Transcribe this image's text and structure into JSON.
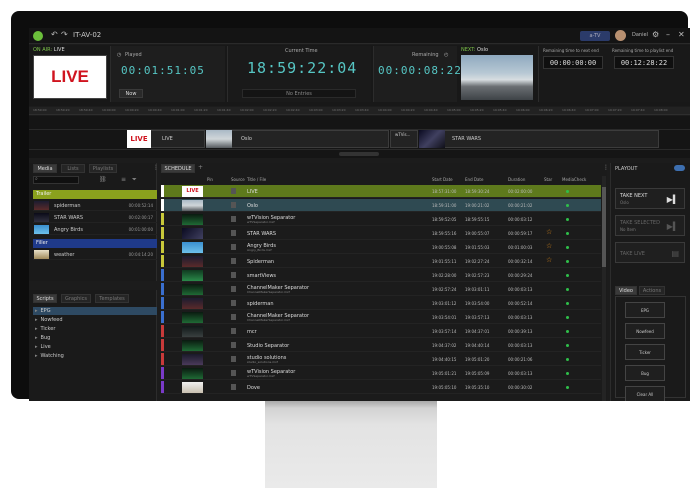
{
  "app": {
    "window_title": "IT-AV-02",
    "badge": "a-TV",
    "user": "Daniel"
  },
  "onair": {
    "label_prefix": "ON AIR:",
    "label_value": "LIVE",
    "live_text": "LIVE",
    "played_label": "Played",
    "played_time": "00:01:51:05",
    "now_button": "Now",
    "current_time_label": "Current Time",
    "current_time": "18:59:22:04",
    "no_entry": "No Entries",
    "remaining_label": "Remaining",
    "remaining_time": "00:00:08:22",
    "next_label": "NEXT:",
    "next_value": "Oslo",
    "rem_next_end_label": "Remaining time to next end",
    "rem_next_end": "00:00:00:00",
    "rem_playlist_end_label": "Remaining time to playlist end",
    "rem_playlist_end": "00:12:28:22"
  },
  "ruler_ticks": [
    "18:59:00",
    "18:59:20",
    "18:59:40",
    "19:00:00",
    "19:00:20",
    "19:00:40",
    "19:01:00",
    "19:01:20",
    "19:01:40",
    "19:02:00",
    "19:02:20",
    "19:02:40",
    "19:03:00",
    "19:03:20",
    "19:03:40",
    "19:04:00",
    "19:04:20",
    "19:04:40",
    "19:05:00",
    "19:05:20",
    "19:05:40",
    "19:06:00",
    "19:06:20",
    "19:06:40",
    "19:07:00",
    "19:07:20",
    "19:07:40",
    "19:08:00"
  ],
  "timeline": {
    "live_text": "LIVE",
    "item1": "LIVE",
    "item2": "Oslo",
    "item3": "wTVis...",
    "item4": "STAR WARS"
  },
  "media": {
    "tabs": [
      "Media",
      "Lists",
      "Playlists"
    ],
    "groups": [
      {
        "name": "Trailer",
        "color": "#8aa11d"
      },
      {
        "name": "Filler",
        "color": "#1f3a8a"
      }
    ],
    "trailer_items": [
      {
        "name": "spiderman",
        "duration": "00:00:52:14"
      },
      {
        "name": "STAR WARS",
        "duration": "00:02:00:17"
      },
      {
        "name": "Angry Birds",
        "duration": "00:01:00:00"
      }
    ],
    "filler_items": [
      {
        "name": "weather",
        "duration": "00:04:14:20"
      }
    ]
  },
  "scripts": {
    "tabs": [
      "Scripts",
      "Graphics",
      "Templates"
    ],
    "items": [
      "EPG",
      "Nowfeed",
      "Ticker",
      "Bug",
      "Live",
      "Watching"
    ],
    "selected": "EPG"
  },
  "schedule": {
    "tab": "SCHEDULE",
    "columns": [
      "Pin",
      "Source",
      "Title / File",
      "Start Date",
      "End Date",
      "Duration",
      "Star",
      "MediaCheck"
    ],
    "rows": [
      {
        "title": "LIVE",
        "sub": "",
        "start": "18:57:31:00",
        "end": "18:59:30:24",
        "dur": "00:02:00:00",
        "star": false,
        "color": "#ffffff",
        "state": "live"
      },
      {
        "title": "Oslo",
        "sub": "",
        "start": "18:59:31:00",
        "end": "19:00:21:02",
        "dur": "00:00:21:02",
        "star": false,
        "color": "#ffffff",
        "state": "next"
      },
      {
        "title": "wTVision Separator",
        "sub": "wTVSeparator.mxf",
        "start": "18:59:52:05",
        "end": "18:59:55:15",
        "dur": "00:00:03:12",
        "star": false,
        "color": "#c8c83a",
        "state": ""
      },
      {
        "title": "STAR WARS",
        "sub": "",
        "start": "18:59:55:16",
        "end": "19:00:55:07",
        "dur": "00:00:59:17",
        "star": true,
        "color": "#c8c83a",
        "state": ""
      },
      {
        "title": "Angry Birds",
        "sub": "Angry_Birds.mxf",
        "start": "19:00:55:08",
        "end": "19:01:55:03",
        "dur": "00:01:00:03",
        "star": true,
        "color": "#c8c83a",
        "state": ""
      },
      {
        "title": "Spiderman",
        "sub": "",
        "start": "19:01:55:11",
        "end": "19:02:27:24",
        "dur": "00:00:32:14",
        "star": true,
        "color": "#c8c83a",
        "state": ""
      },
      {
        "title": "smartViews",
        "sub": "",
        "start": "19:02:28:00",
        "end": "19:02:57:23",
        "dur": "00:00:29:24",
        "star": false,
        "color": "#3a6fcf",
        "state": ""
      },
      {
        "title": "ChannelMaker Separator",
        "sub": "ChannelMakerSeparator.mxf",
        "start": "19:02:57:24",
        "end": "19:03:01:11",
        "dur": "00:00:03:13",
        "star": false,
        "color": "#3a6fcf",
        "state": ""
      },
      {
        "title": "spiderman",
        "sub": "",
        "start": "19:03:01:12",
        "end": "19:03:54:00",
        "dur": "00:00:52:14",
        "star": false,
        "color": "#3a6fcf",
        "state": ""
      },
      {
        "title": "ChannelMaker Separator",
        "sub": "ChannelMakerSeparator.mxf",
        "start": "19:03:54:01",
        "end": "19:03:57:13",
        "dur": "00:00:03:13",
        "star": false,
        "color": "#3a6fcf",
        "state": ""
      },
      {
        "title": "mcr",
        "sub": "",
        "start": "19:03:57:14",
        "end": "19:04:37:01",
        "dur": "00:00:39:13",
        "star": false,
        "color": "#c83a3a",
        "state": ""
      },
      {
        "title": "Studio Separator",
        "sub": "",
        "start": "19:04:37:02",
        "end": "19:04:40:14",
        "dur": "00:00:03:13",
        "star": false,
        "color": "#c83a3a",
        "state": ""
      },
      {
        "title": "studio solutions",
        "sub": "studio_solutions.mxf",
        "start": "19:04:40:15",
        "end": "19:05:01:20",
        "dur": "00:00:21:06",
        "star": false,
        "color": "#c83a3a",
        "state": ""
      },
      {
        "title": "wTVision Separator",
        "sub": "wTVSeparator.mxf",
        "start": "19:05:01:21",
        "end": "19:05:05:09",
        "dur": "00:00:03:13",
        "star": false,
        "color": "#7a3ac8",
        "state": ""
      },
      {
        "title": "Dove",
        "sub": "",
        "start": "19:05:05:10",
        "end": "19:05:35:10",
        "dur": "00:00:30:02",
        "star": false,
        "color": "#7a3ac8",
        "state": ""
      }
    ]
  },
  "playout": {
    "title": "PLAYOUT",
    "take_next": "TAKE NEXT",
    "take_next_sub": "Oslo",
    "take_selected": "TAKE SELECTED",
    "take_selected_sub": "No Item",
    "take_live": "TAKE LIVE",
    "tabs": [
      "Video",
      "Actions"
    ],
    "graphics": [
      "EPG",
      "Nowfeed",
      "Ticker",
      "Bug",
      "Clear All"
    ]
  }
}
